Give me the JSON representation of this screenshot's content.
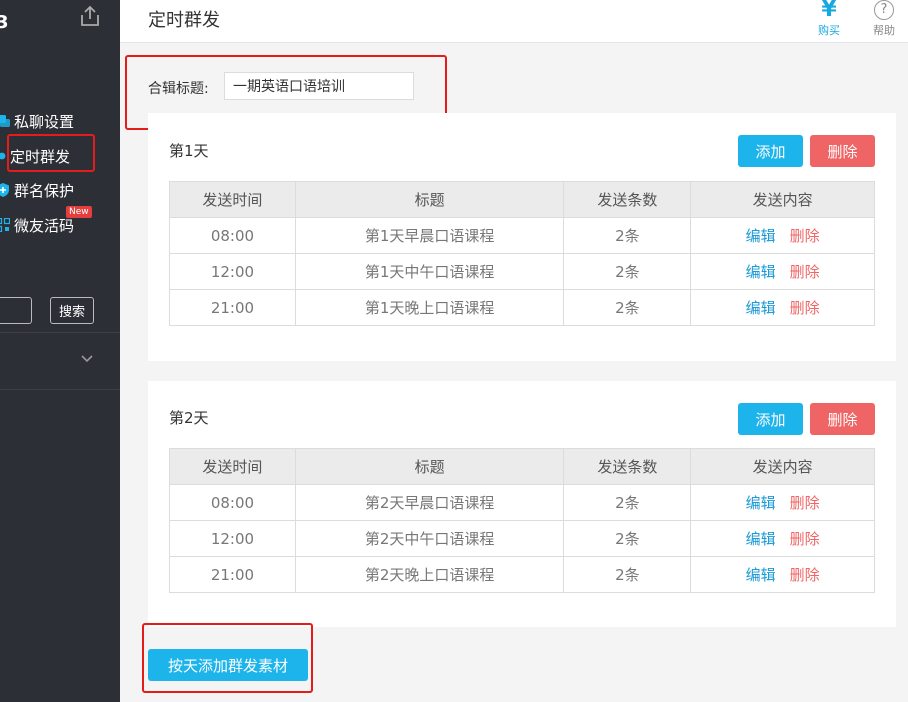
{
  "sidebar": {
    "logo_fragment": "3",
    "items": [
      {
        "label": "私聊设置",
        "icon": "chat-icon"
      },
      {
        "label": "定时群发",
        "icon": "clock-icon"
      },
      {
        "label": "群名保护",
        "icon": "shield-icon"
      },
      {
        "label": "微友活码",
        "icon": "qrcode-icon"
      }
    ],
    "new_badge": "New",
    "search_button": "搜索"
  },
  "header": {
    "title": "定时群发",
    "buy_symbol": "¥",
    "buy_label": "购买",
    "help_symbol": "?",
    "help_label": "帮助"
  },
  "album": {
    "title_label": "合辑标题:",
    "title_value": "一期英语口语培训"
  },
  "columns": [
    "发送时间",
    "标题",
    "发送条数",
    "发送内容"
  ],
  "days": [
    {
      "title": "第1天",
      "add_label": "添加",
      "delete_label": "删除",
      "rows": [
        {
          "time": "08:00",
          "title": "第1天早晨口语课程",
          "count": "2条",
          "edit": "编辑",
          "delete": "删除"
        },
        {
          "time": "12:00",
          "title": "第1天中午口语课程",
          "count": "2条",
          "edit": "编辑",
          "delete": "删除"
        },
        {
          "time": "21:00",
          "title": "第1天晚上口语课程",
          "count": "2条",
          "edit": "编辑",
          "delete": "删除"
        }
      ]
    },
    {
      "title": "第2天",
      "add_label": "添加",
      "delete_label": "删除",
      "rows": [
        {
          "time": "08:00",
          "title": "第2天早晨口语课程",
          "count": "2条",
          "edit": "编辑",
          "delete": "删除"
        },
        {
          "time": "12:00",
          "title": "第2天中午口语课程",
          "count": "2条",
          "edit": "编辑",
          "delete": "删除"
        },
        {
          "time": "21:00",
          "title": "第2天晚上口语课程",
          "count": "2条",
          "edit": "编辑",
          "delete": "删除"
        }
      ]
    }
  ],
  "add_day_button": "按天添加群发素材",
  "colors": {
    "accent_blue": "#1db4ec",
    "danger_red": "#ef6464",
    "sidebar_bg": "#2d2f36",
    "highlight_red": "#e51c1c"
  }
}
